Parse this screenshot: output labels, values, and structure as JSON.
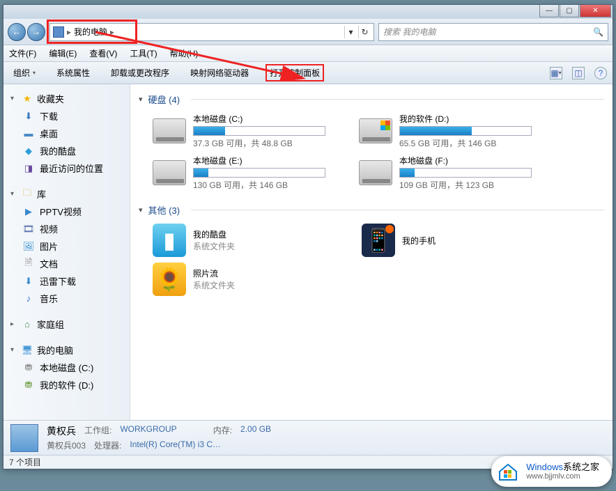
{
  "window": {
    "minimize": "—",
    "maximize": "▢",
    "close": "✕"
  },
  "nav": {
    "back": "←",
    "forward": "→",
    "path_sep1": "▸",
    "location": "我的电脑",
    "path_sep2": "▸",
    "dropdown": "▾",
    "refresh": "↻"
  },
  "search": {
    "placeholder": "搜索 我的电脑",
    "icon": "🔍"
  },
  "menus": {
    "file": "文件(F)",
    "edit": "编辑(E)",
    "view": "查看(V)",
    "tools": "工具(T)",
    "help": "帮助(H)"
  },
  "toolbar": {
    "organize": "组织",
    "sys_props": "系统属性",
    "uninstall": "卸载或更改程序",
    "map_drive": "映射网络驱动器",
    "control_panel": "打开控制面板",
    "dd": "▾"
  },
  "sidebar": {
    "favorites": "收藏夹",
    "downloads": "下载",
    "desktop": "桌面",
    "cooldisk": "我的酷盘",
    "recent": "最近访问的位置",
    "libraries": "库",
    "pptv": "PPTV视频",
    "videos": "视频",
    "pictures": "图片",
    "documents": "文档",
    "xunlei": "迅雷下载",
    "music": "音乐",
    "homegroup": "家庭组",
    "computer": "我的电脑",
    "drive_c": "本地磁盘 (C:)",
    "drive_d": "我的软件 (D:)"
  },
  "categories": {
    "hdd": "硬盘 (4)",
    "other": "其他 (3)"
  },
  "drives": [
    {
      "name": "本地磁盘 (C:)",
      "stats": "37.3 GB 可用，共 48.8 GB",
      "fill": 24,
      "os": false
    },
    {
      "name": "我的软件 (D:)",
      "stats": "65.5 GB 可用，共 146 GB",
      "fill": 55,
      "os": true
    },
    {
      "name": "本地磁盘 (E:)",
      "stats": "130 GB 可用，共 146 GB",
      "fill": 11,
      "os": false
    },
    {
      "name": "本地磁盘 (F:)",
      "stats": "109 GB 可用，共 123 GB",
      "fill": 11,
      "os": false
    }
  ],
  "others": [
    {
      "name": "我的酷盘",
      "sub": "系统文件夹",
      "cls": "oi-cool"
    },
    {
      "name": "我的手机",
      "sub": "",
      "cls": "oi-phone"
    },
    {
      "name": "照片流",
      "sub": "系统文件夹",
      "cls": "oi-photo"
    }
  ],
  "details": {
    "name": "黄权兵",
    "sub_name": "黄权兵003",
    "workgroup_label": "工作组:",
    "workgroup": "WORKGROUP",
    "cpu_label": "处理器:",
    "cpu": "Intel(R) Core(TM) i3 C…",
    "mem_label": "内存:",
    "mem": "2.00 GB"
  },
  "status": "7 个项目",
  "watermark": {
    "brand_blue": "Windows",
    "brand_rest": "系统之家",
    "url": "www.bjjmlv.com"
  }
}
